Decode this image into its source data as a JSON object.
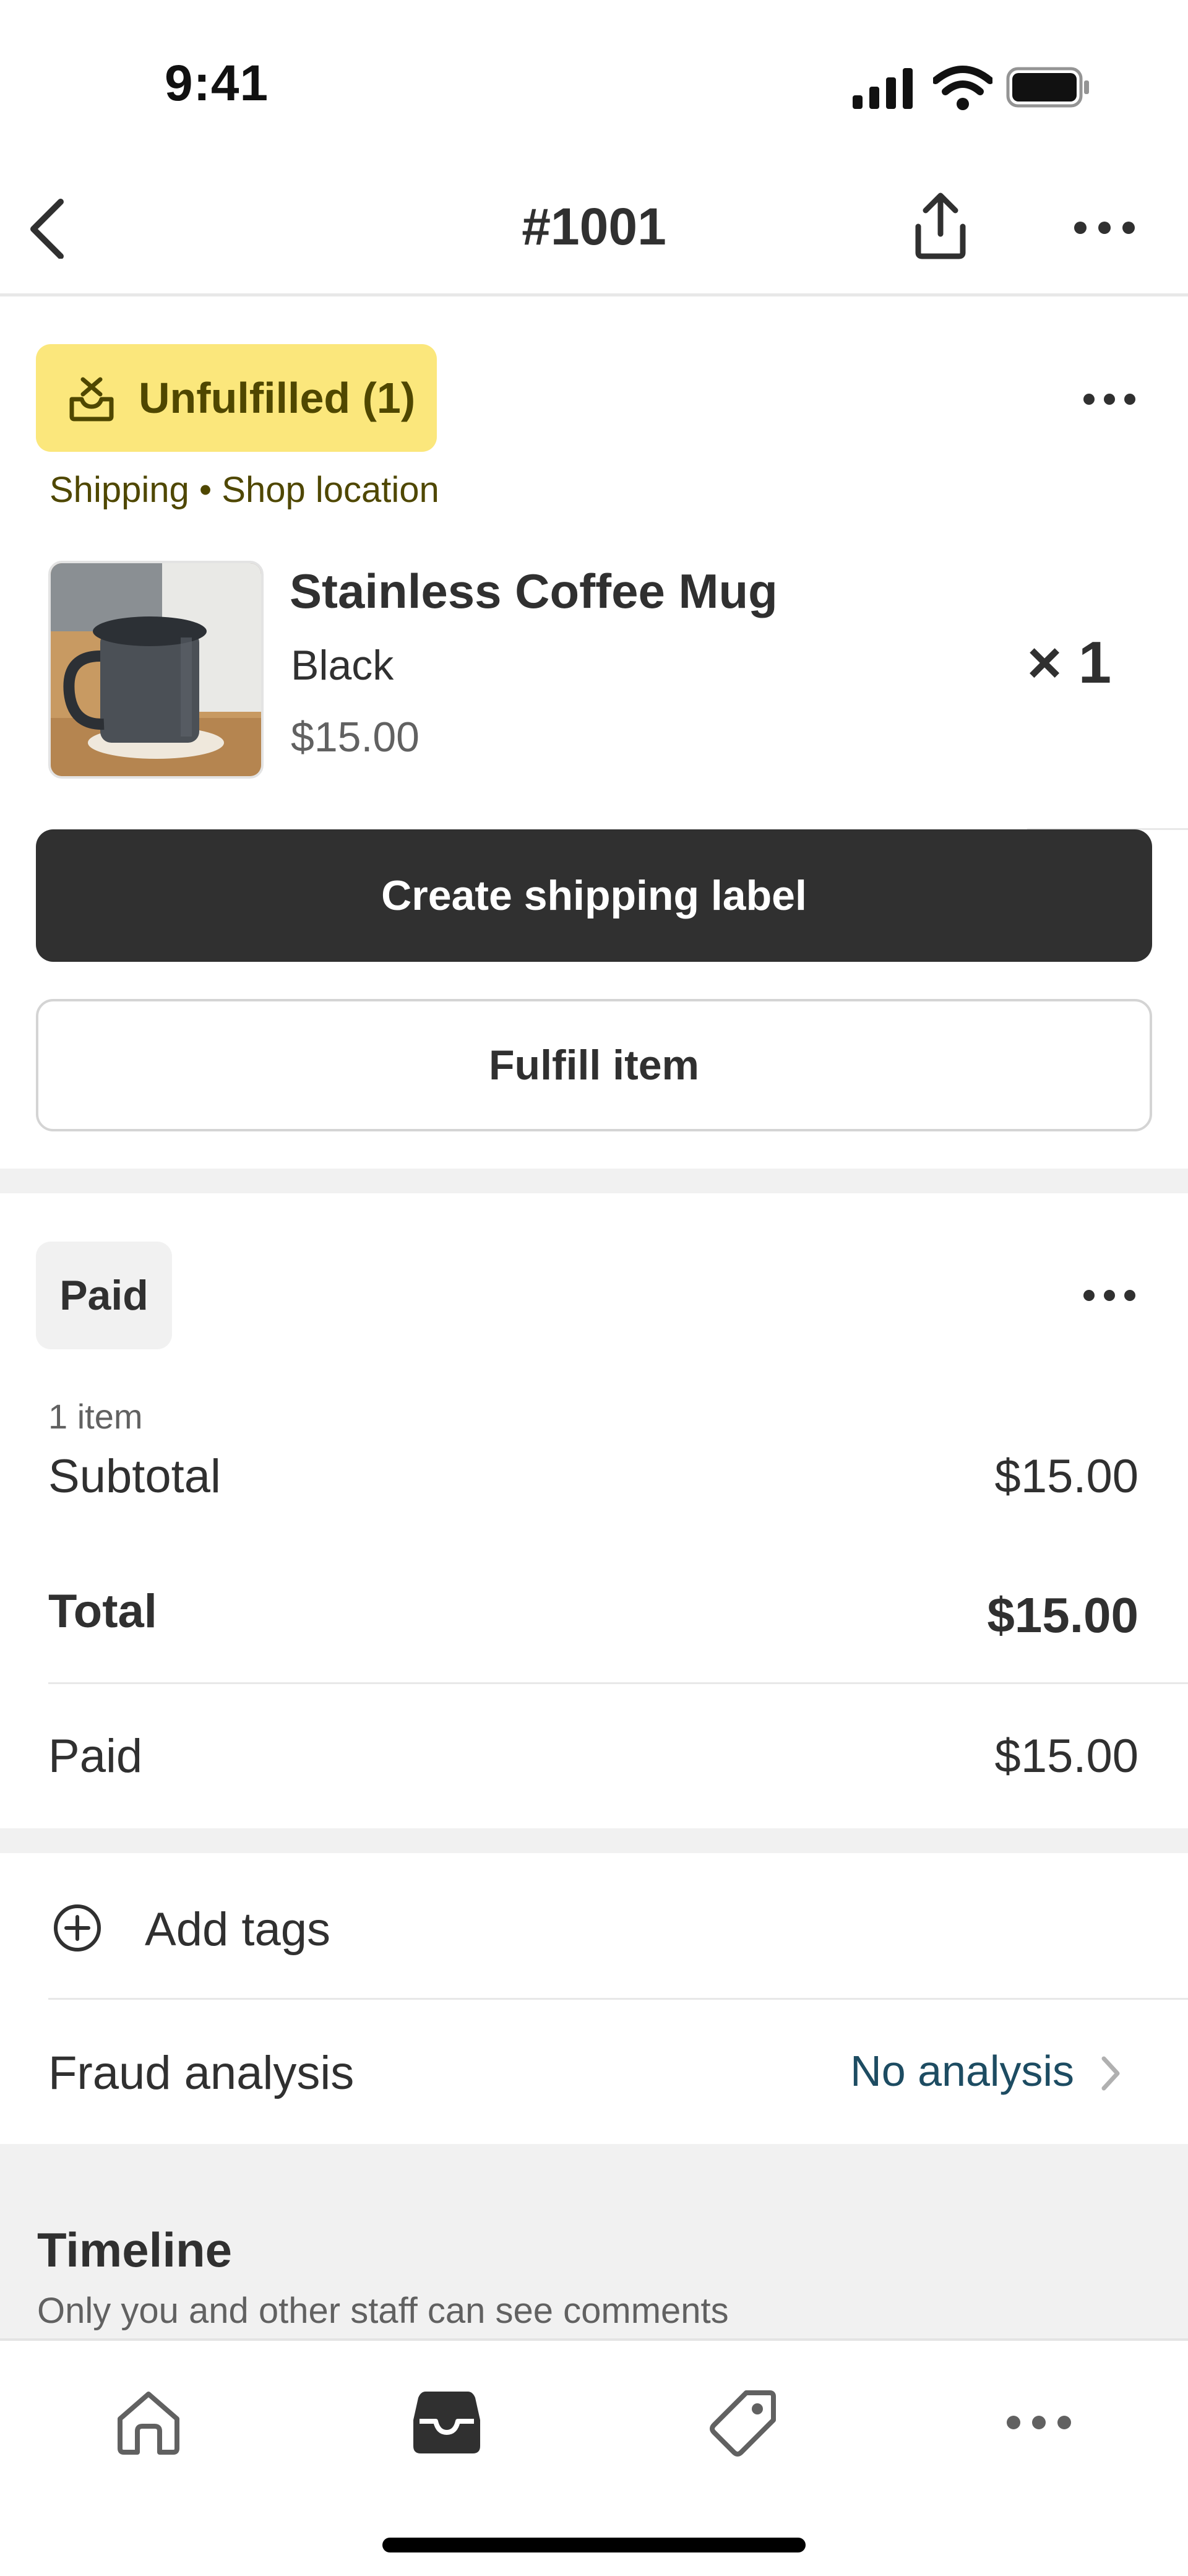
{
  "status_bar": {
    "time": "9:41"
  },
  "nav": {
    "title": "#1001"
  },
  "fulfillment": {
    "status_label": "Unfulfilled (1)",
    "subtitle": "Shipping • Shop location",
    "item": {
      "title": "Stainless Coffee Mug",
      "variant": "Black",
      "price": "$15.00",
      "quantity": "× 1"
    },
    "primary_button": "Create shipping label",
    "secondary_button": "Fulfill item"
  },
  "payment": {
    "status_label": "Paid",
    "item_count": "1 item",
    "subtotal_label": "Subtotal",
    "subtotal_value": "$15.00",
    "total_label": "Total",
    "total_value": "$15.00",
    "paid_label": "Paid",
    "paid_value": "$15.00"
  },
  "tags": {
    "add_label": "Add tags"
  },
  "fraud": {
    "label": "Fraud analysis",
    "value": "No analysis"
  },
  "timeline": {
    "title": "Timeline",
    "subtitle": "Only you and other staff can see comments"
  },
  "tab_bar": {
    "icons": [
      "home-icon",
      "orders-inbox-icon",
      "products-tag-icon",
      "more-icon"
    ],
    "active_index": 1
  },
  "colors": {
    "unfulfilled_badge": "#fbe77c",
    "unfulfilled_text": "#4f4700",
    "primary_button": "#303030",
    "link": "#1d4c62",
    "section_gap": "#f1f1f1"
  }
}
